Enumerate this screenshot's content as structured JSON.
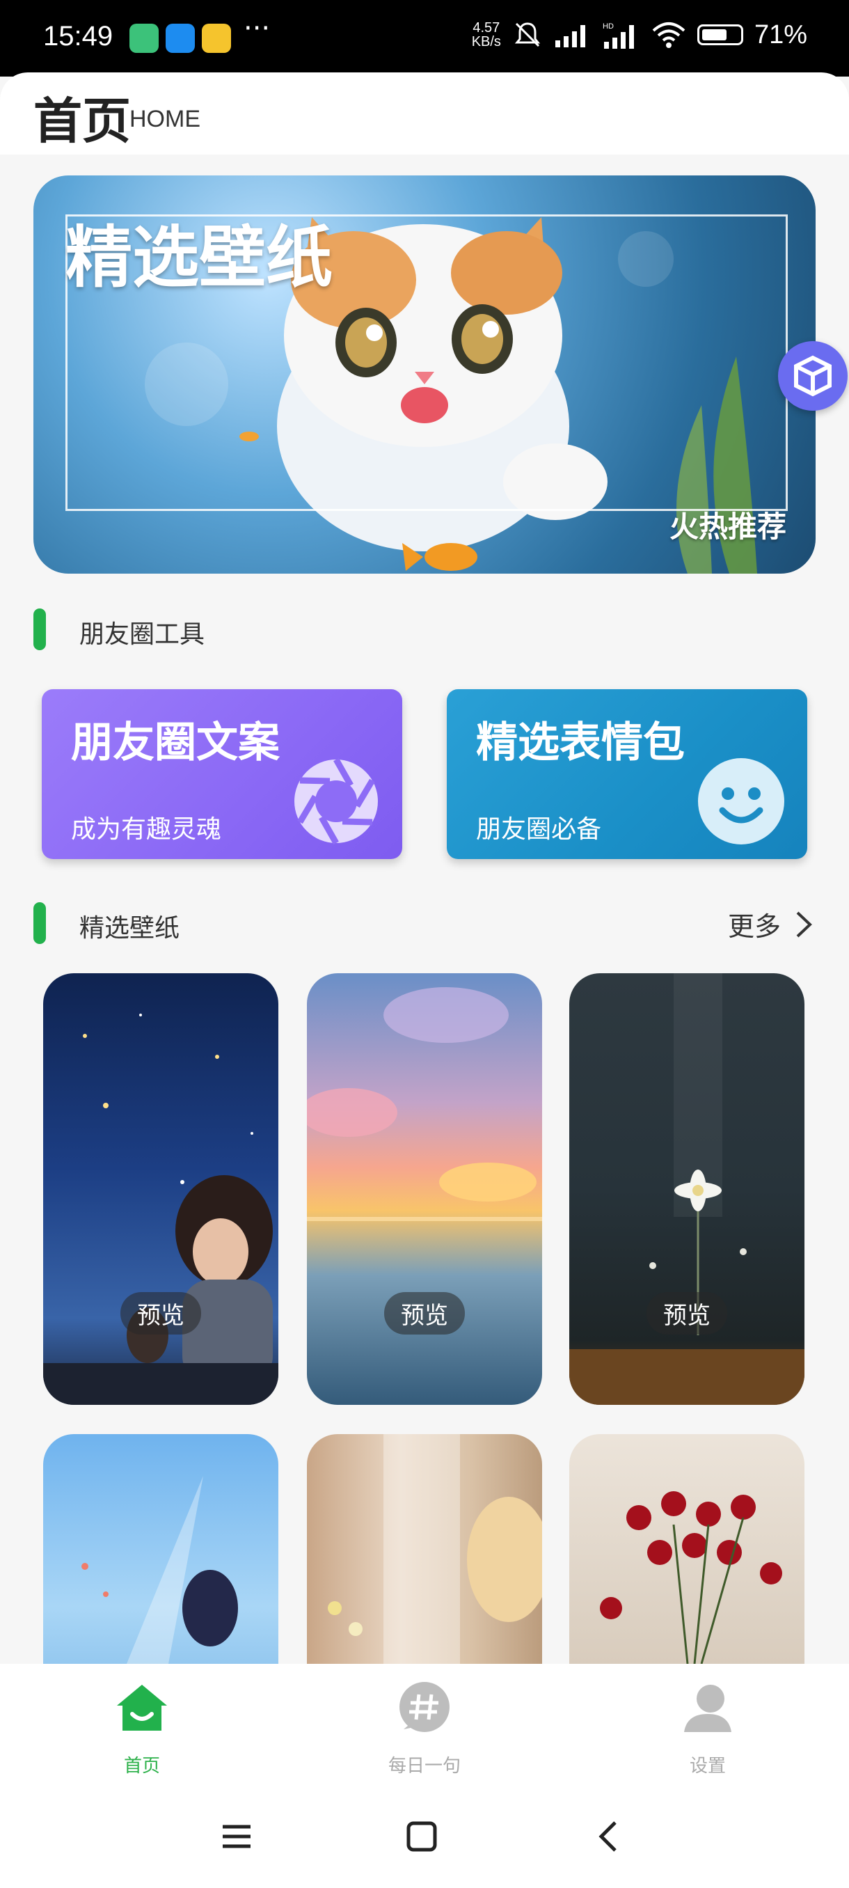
{
  "status_bar": {
    "time": "15:49",
    "speed_value": "4.57",
    "speed_unit": "KB/s",
    "battery": "71%",
    "battery_level": 0.71,
    "more_dots": "···"
  },
  "header": {
    "title": "首页",
    "subtitle": "HOME"
  },
  "banner": {
    "title": "精选壁纸",
    "tag": "火热推荐"
  },
  "friends_tools": {
    "section_title": "朋友圈工具",
    "cards": [
      {
        "title": "朋友圈文案",
        "subtitle": "成为有趣灵魂",
        "icon": "shutter-icon",
        "color": "#8b6cf6"
      },
      {
        "title": "精选表情包",
        "subtitle": "朋友圈必备",
        "icon": "smiley-icon",
        "color": "#1e93c9"
      }
    ]
  },
  "wallpapers": {
    "section_title": "精选壁纸",
    "more_label": "更多",
    "preview_label": "预览"
  },
  "bottom_nav": {
    "items": [
      {
        "label": "首页",
        "icon": "home-icon",
        "active": true
      },
      {
        "label": "每日一句",
        "icon": "hashtag-icon",
        "active": false
      },
      {
        "label": "设置",
        "icon": "user-icon",
        "active": false
      }
    ]
  },
  "colors": {
    "accent": "#22b14c",
    "purple_card": "#8b6cf6",
    "blue_card": "#1e93c9"
  }
}
